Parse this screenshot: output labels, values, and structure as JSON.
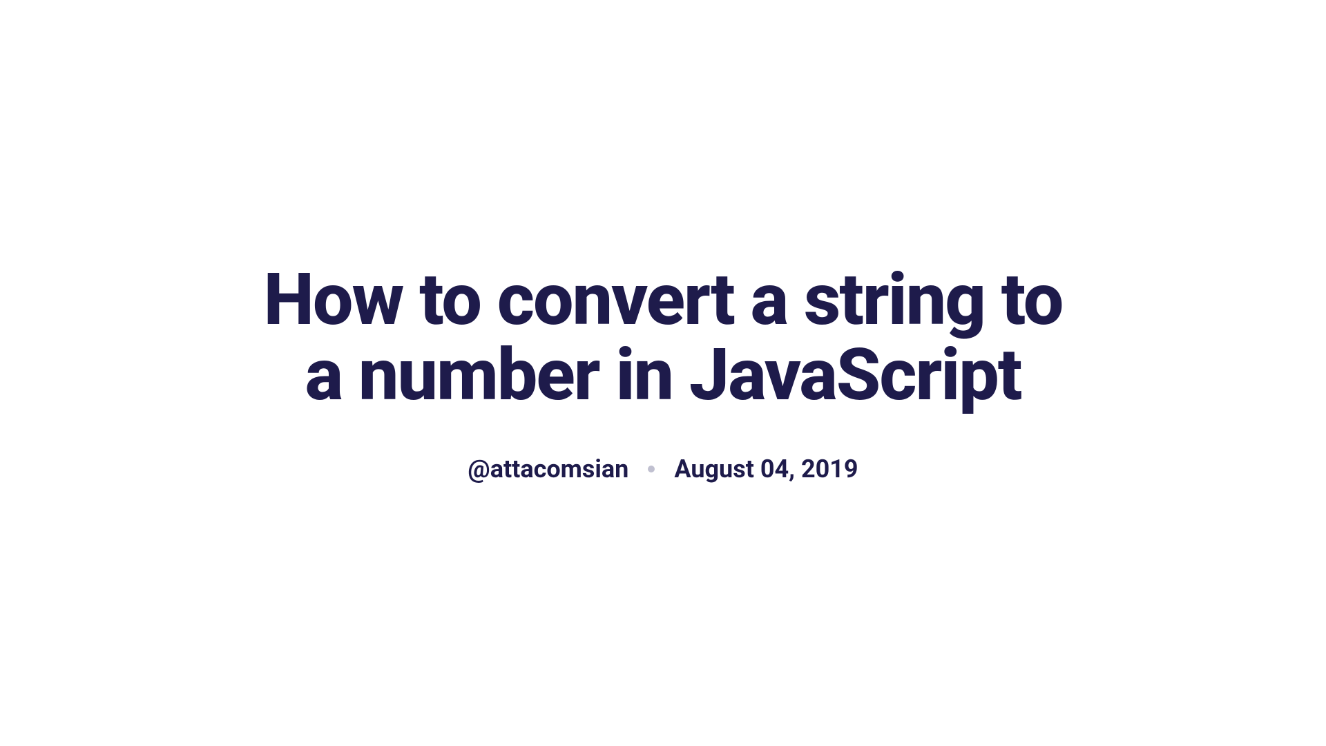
{
  "article": {
    "title": "How to convert a string to a number in JavaScript",
    "author": "@attacomsian",
    "date": "August 04, 2019"
  }
}
